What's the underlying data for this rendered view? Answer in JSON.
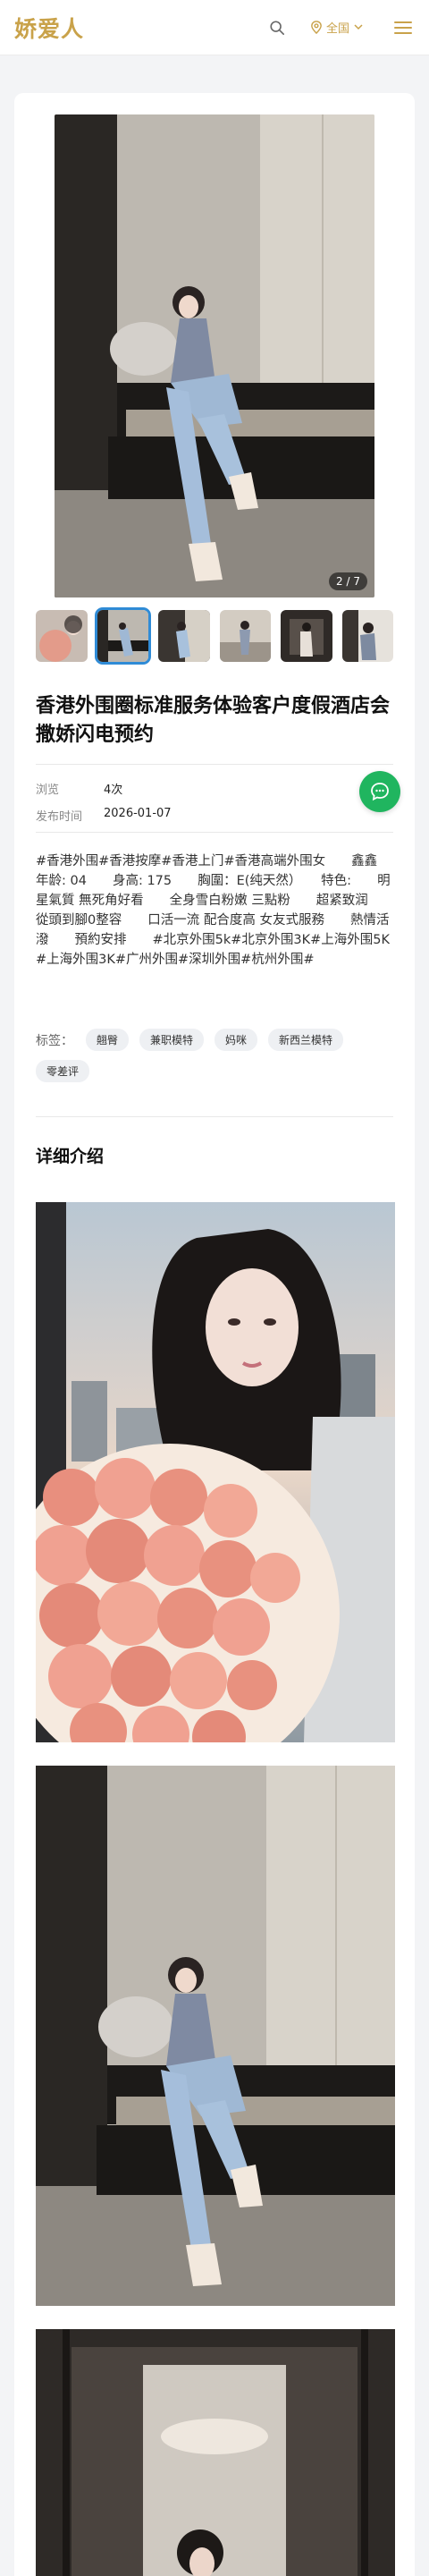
{
  "header": {
    "logo": "娇爱人",
    "region_label": "全国",
    "icons": {
      "search": "search-icon",
      "location": "map-pin-icon",
      "dropdown": "chevron-down-icon",
      "menu": "hamburger-menu-icon"
    },
    "accent_color": "#c9a24a"
  },
  "gallery": {
    "counter": "2 / 7",
    "active_index": 1,
    "thumbnail_count": 6
  },
  "post": {
    "title": "香港外围圈标准服务体验客户度假酒店会撒娇闪电预约",
    "views_label": "浏览",
    "views_value": "4次",
    "date_label": "发布时间",
    "date_value": "2026-01-07",
    "description": "#香港外围#香港按摩#香港上门#香港高端外围女　　鑫鑫　　年龄: 04　　身高: 175　　胸圍：E(纯天然）　　特色:　　明星氣質 無死角好看　　全身雪白粉嫩 三點粉　　超紧致润　　從頭到腳0整容　　口活一流 配合度高 女友式服務　　熱情活潑　　預約安排　　#北京外围5k#北京外围3K#上海外围5K#上海外围3K#广州外围#深圳外围#杭州外围#"
  },
  "chat": {
    "icon": "chat-bubble-icon",
    "color": "#20b55f"
  },
  "tags": {
    "label": "标签：",
    "items": [
      "翹臀",
      "兼职模特",
      "妈咪",
      "新西兰模特",
      "零差评"
    ]
  },
  "details": {
    "section_title": "详细介绍"
  }
}
